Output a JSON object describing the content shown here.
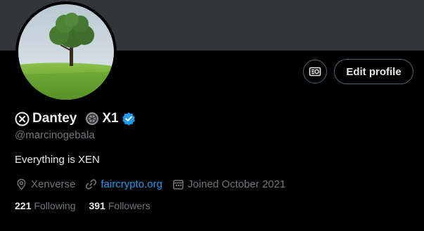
{
  "profile": {
    "display_name_part1": "Dantey",
    "display_name_part2": "X1",
    "handle": "@marcinogebala",
    "bio": "Everything is XEN",
    "location": "Xenverse",
    "website": "faircrypto.org",
    "joined": "Joined October 2021"
  },
  "actions": {
    "edit_profile_label": "Edit profile",
    "secondary_icon": "switch-account-icon"
  },
  "stats": {
    "following_count": "221",
    "following_label": "Following",
    "followers_count": "391",
    "followers_label": "Followers"
  },
  "colors": {
    "background": "#000000",
    "banner": "#333639",
    "link": "#1d9bf0",
    "verified": "#1d9bf0",
    "muted_text": "#71767b",
    "primary_text": "#e7e9ea"
  },
  "icons": {
    "name_prefix": "xen-circle-icon",
    "name_middle": "x1-emblem-icon",
    "verified": "verified-badge-icon",
    "location": "location-pin-icon",
    "website": "link-icon",
    "joined": "calendar-icon"
  }
}
